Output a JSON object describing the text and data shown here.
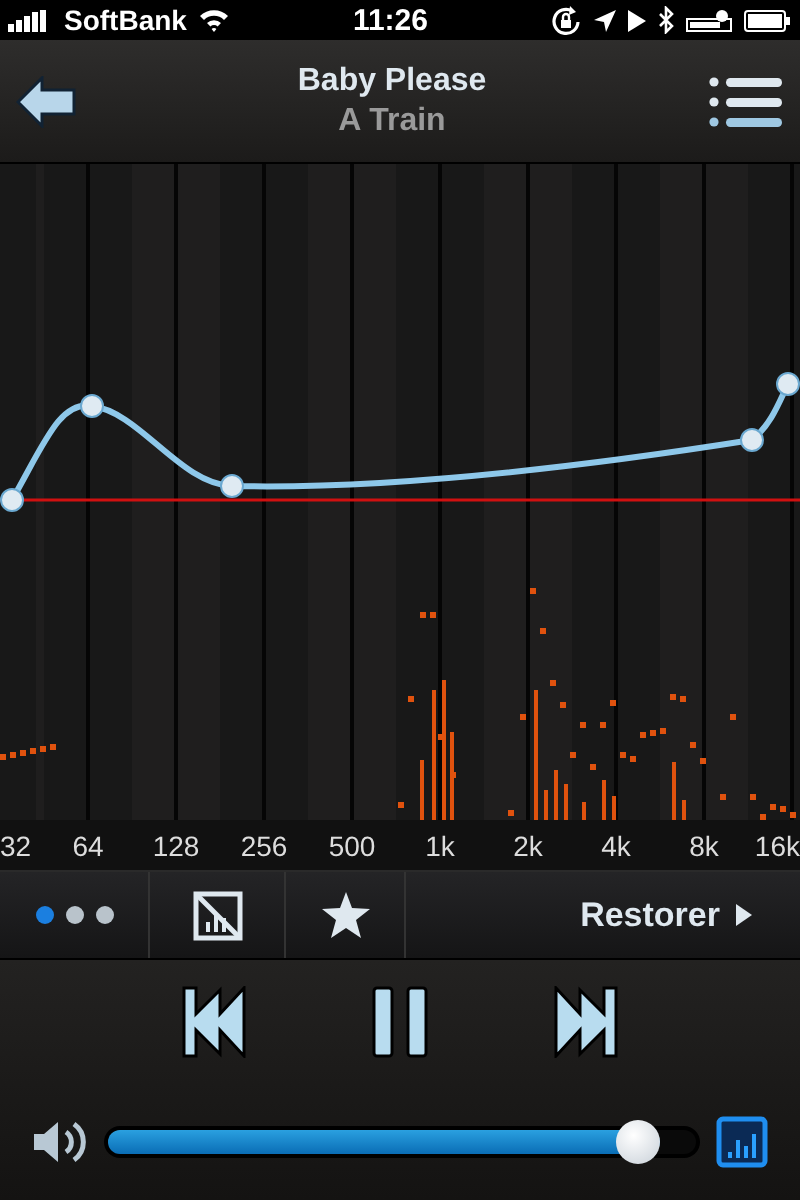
{
  "status_bar": {
    "carrier": "SoftBank",
    "time": "11:26"
  },
  "now_playing": {
    "title": "Baby Please",
    "artist": "A Train"
  },
  "equalizer": {
    "frequency_labels": [
      "32",
      "64",
      "128",
      "256",
      "500",
      "1k",
      "2k",
      "4k",
      "8k",
      "16k"
    ]
  },
  "toolbar": {
    "page_dots": [
      {
        "selected": true
      },
      {
        "selected": false
      },
      {
        "selected": false
      }
    ],
    "preset": "Restorer"
  },
  "volume": {
    "level": 0.94
  }
}
